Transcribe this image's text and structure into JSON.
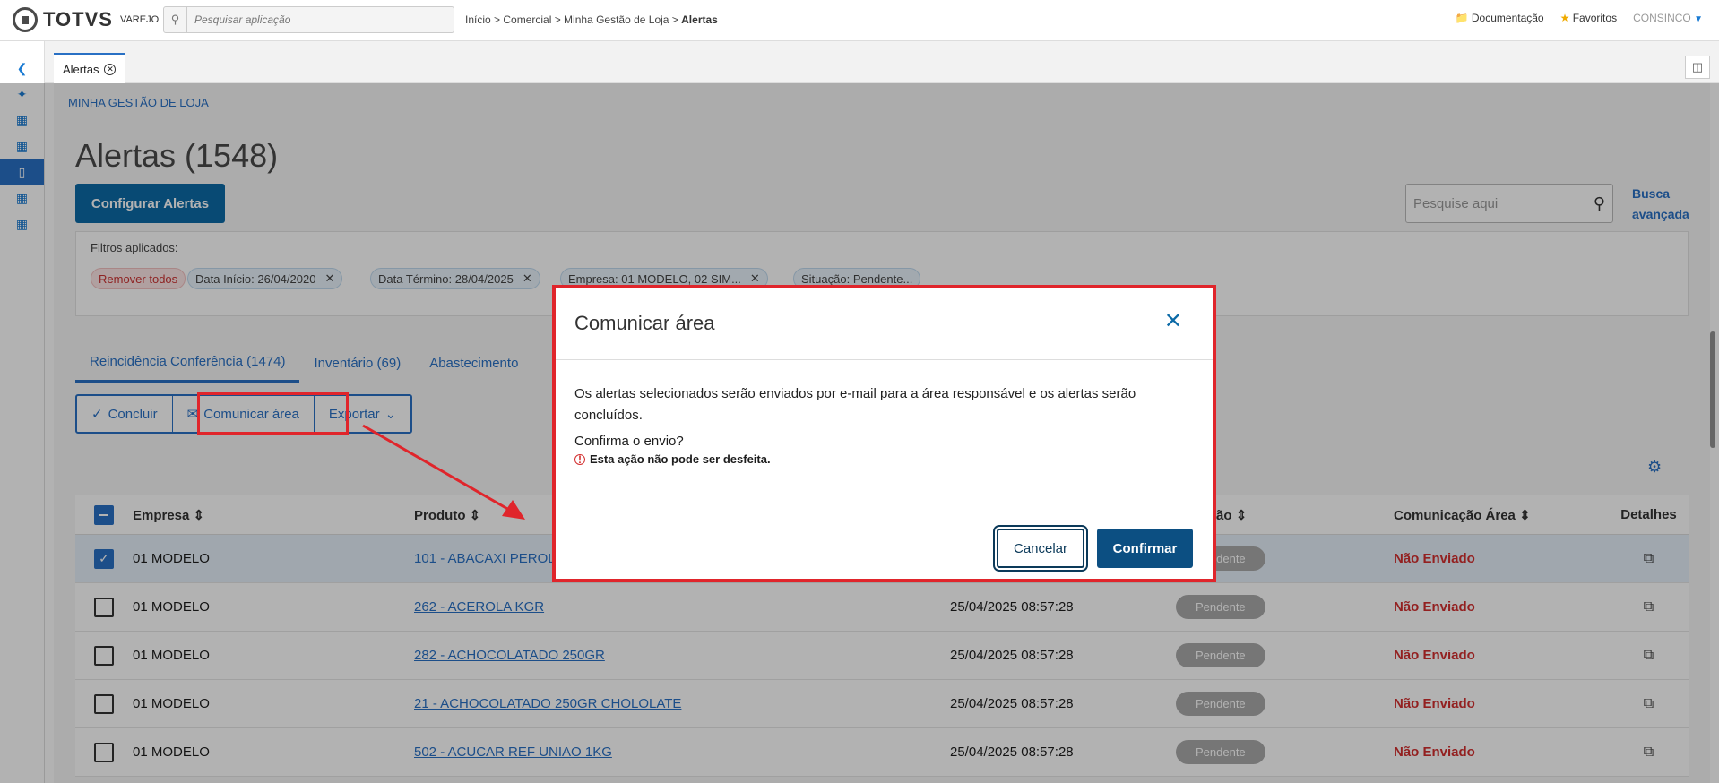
{
  "brand": {
    "name": "TOTVS",
    "sub": "VAREJO"
  },
  "search": {
    "placeholder": "Pesquisar aplicação"
  },
  "breadcrumb": {
    "path": "Início > Comercial > Minha Gestão de Loja > ",
    "current": "Alertas"
  },
  "topnav": {
    "docs": "Documentação",
    "favorites": "Favoritos",
    "user": "CONSINCO"
  },
  "tab": {
    "label": "Alertas"
  },
  "page": {
    "section": "MINHA GESTÃO DE LOJA",
    "title": "Alertas (1548)",
    "configure_label": "Configurar Alertas",
    "search_placeholder": "Pesquise aqui",
    "advanced_1": "Busca",
    "advanced_2": "avançada"
  },
  "filters": {
    "label": "Filtros aplicados:",
    "remove_all": "Remover todos",
    "chips": [
      "Data Início: 26/04/2020",
      "Data Término: 28/04/2025",
      "Empresa: 01 MODELO, 02 SIM...",
      "Situação: Pendente..."
    ]
  },
  "subtabs": [
    "Reincidência Conferência (1474)",
    "Inventário (69)",
    "Abastecimento"
  ],
  "actions": {
    "conclude": "Concluir",
    "communicate": "Comunicar área",
    "export": "Exportar"
  },
  "table": {
    "headers": [
      "Empresa",
      "Produto",
      "",
      "Situação",
      "Comunicação Área",
      "Detalhes"
    ],
    "rows": [
      {
        "empresa": "01 MODELO",
        "produto": "101 - ABACAXI PEROLA",
        "data": "",
        "status": "Pendente",
        "com": "Não Enviado",
        "checked": true
      },
      {
        "empresa": "01 MODELO",
        "produto": "262 - ACEROLA KGR",
        "data": "25/04/2025 08:57:28",
        "status": "Pendente",
        "com": "Não Enviado",
        "checked": false
      },
      {
        "empresa": "01 MODELO",
        "produto": "282 - ACHOCOLATADO 250GR",
        "data": "25/04/2025 08:57:28",
        "status": "Pendente",
        "com": "Não Enviado",
        "checked": false
      },
      {
        "empresa": "01 MODELO",
        "produto": "21 - ACHOCOLATADO 250GR CHOLOLATE",
        "data": "25/04/2025 08:57:28",
        "status": "Pendente",
        "com": "Não Enviado",
        "checked": false
      },
      {
        "empresa": "01 MODELO",
        "produto": "502 - ACUCAR REF UNIAO 1KG",
        "data": "25/04/2025 08:57:28",
        "status": "Pendente",
        "com": "Não Enviado",
        "checked": false
      }
    ]
  },
  "modal": {
    "title": "Comunicar área",
    "body": "Os alertas selecionados serão enviados por e-mail para a área responsável e os alertas serão concluídos.",
    "question": "Confirma o envio?",
    "warning": "Esta ação não pode ser desfeita.",
    "cancel": "Cancelar",
    "confirm": "Confirmar"
  },
  "colors": {
    "accent": "#2970c4",
    "primary": "#0c6aa7",
    "highlight": "#e0252b",
    "danger": "#d32f2f"
  }
}
